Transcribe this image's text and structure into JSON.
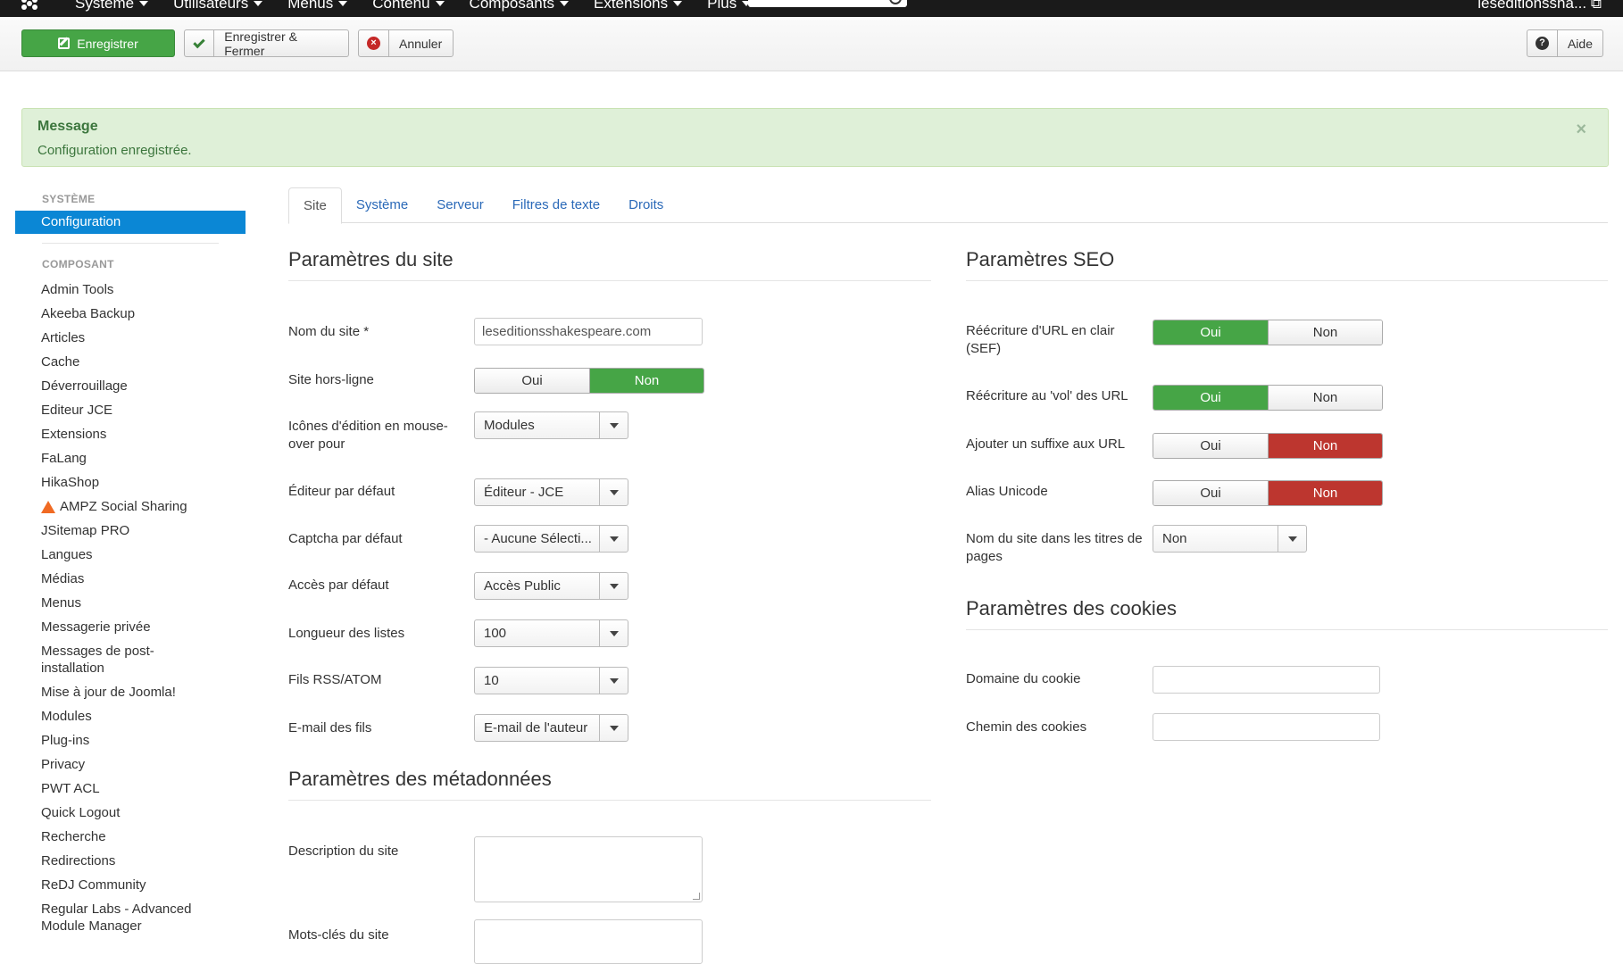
{
  "topnav": {
    "menu": [
      "Système",
      "Utilisateurs",
      "Menus",
      "Contenu",
      "Composants",
      "Extensions",
      "Plus"
    ],
    "user": "leseditionssha... ⧉"
  },
  "toolbar": {
    "save": "Enregistrer",
    "save_close": "Enregistrer & Fermer",
    "cancel": "Annuler",
    "help": "Aide"
  },
  "alert": {
    "heading": "Message",
    "text": "Configuration enregistrée.",
    "close": "×"
  },
  "sidebar": {
    "system_head": "SYSTÈME",
    "active": "Configuration",
    "component_head": "COMPOSANT",
    "items": [
      "Admin Tools",
      "Akeeba Backup",
      "Articles",
      "Cache",
      "Déverrouillage",
      "Editeur JCE",
      "Extensions",
      "FaLang",
      "HikaShop",
      "AMPZ Social Sharing",
      "JSitemap PRO",
      "Langues",
      "Médias",
      "Menus",
      "Messagerie privée",
      "Messages de post-installation",
      "Mise à jour de Joomla!",
      "Modules",
      "Plug-ins",
      "Privacy",
      "PWT ACL",
      "Quick Logout",
      "Recherche",
      "Redirections",
      "ReDJ Community",
      "Regular Labs - Advanced Module Manager"
    ]
  },
  "tabs": [
    "Site",
    "Système",
    "Serveur",
    "Filtres de texte",
    "Droits"
  ],
  "site": {
    "title": "Paramètres du site",
    "site_name_label": "Nom du site *",
    "site_name_value": "leseditionsshakespeare.com",
    "offline_label": "Site hors-ligne",
    "offline_yes": "Oui",
    "offline_no": "Non",
    "hover_label": "Icônes d'édition en mouse-over pour",
    "hover_value": "Modules",
    "editor_label": "Éditeur par défaut",
    "editor_value": "Éditeur - JCE",
    "captcha_label": "Captcha par défaut",
    "captcha_value": "- Aucune Sélecti...",
    "access_label": "Accès par défaut",
    "access_value": "Accès Public",
    "list_label": "Longueur des listes",
    "list_value": "100",
    "rss_label": "Fils RSS/ATOM",
    "rss_value": "10",
    "email_label": "E-mail des fils",
    "email_value": "E-mail de l'auteur"
  },
  "meta": {
    "title": "Paramètres des métadonnées",
    "desc_label": "Description du site",
    "keywords_label": "Mots-clés du site"
  },
  "seo": {
    "title": "Paramètres SEO",
    "sef_label": "Réécriture d'URL en clair (SEF)",
    "rewrite_label": "Réécriture au 'vol' des URL",
    "suffix_label": "Ajouter un suffixe aux URL",
    "unicode_label": "Alias Unicode",
    "sitename_label": "Nom du site dans les titres de pages",
    "sitename_value": "Non",
    "yes": "Oui",
    "no": "Non"
  },
  "cookies": {
    "title": "Paramètres des cookies",
    "domain_label": "Domaine du cookie",
    "path_label": "Chemin des cookies"
  },
  "colors": {
    "green": "#46a546",
    "red": "#bd362f",
    "blue": "#0b87d5"
  }
}
